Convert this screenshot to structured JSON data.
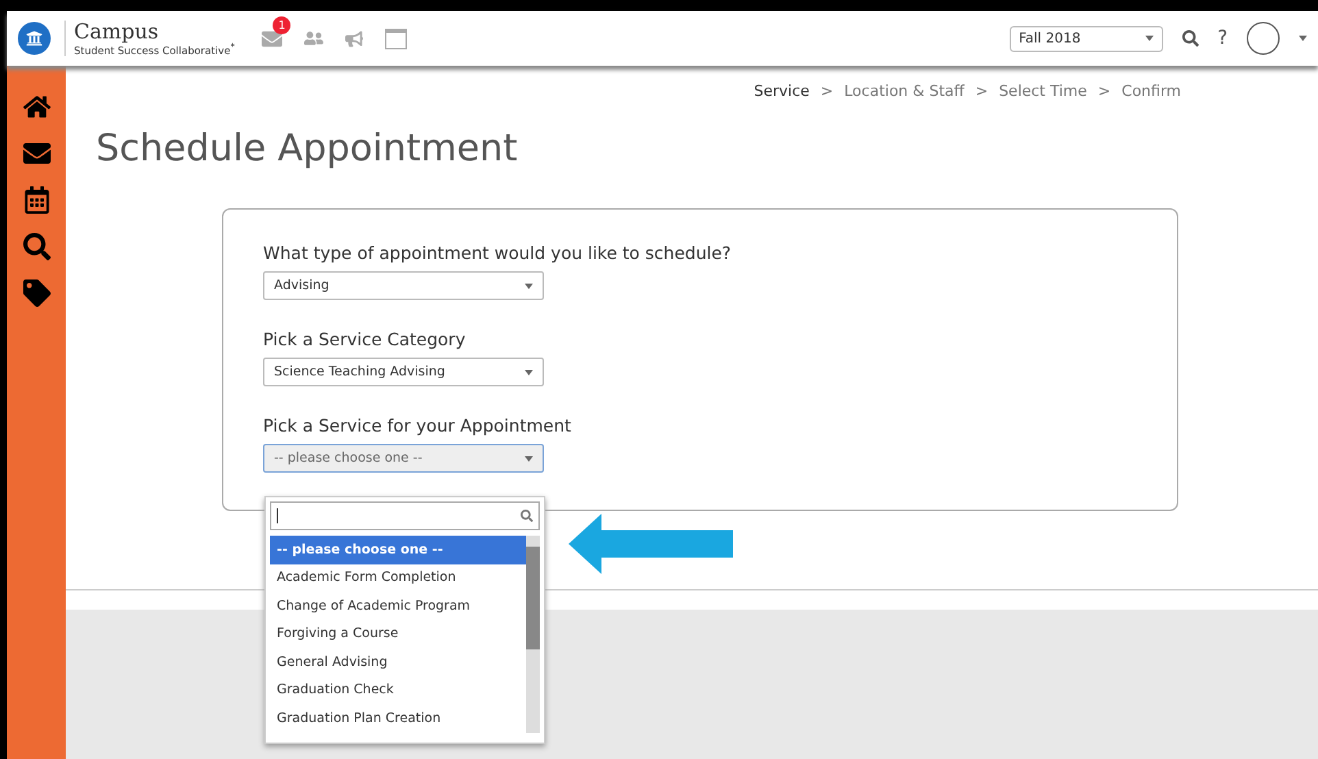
{
  "header": {
    "brand": "Campus",
    "subtitle": "Student Success Collaborative",
    "trademark": "*",
    "notification_count": "1",
    "term": "Fall 2018",
    "help": "?"
  },
  "sidebar": {
    "items": [
      {
        "kind": "home"
      },
      {
        "kind": "mail"
      },
      {
        "kind": "calendar"
      },
      {
        "kind": "search"
      },
      {
        "kind": "tag"
      }
    ]
  },
  "breadcrumb": [
    {
      "label": "Service",
      "selected": true
    },
    {
      "label": "Location & Staff",
      "selected": false
    },
    {
      "label": "Select Time",
      "selected": false
    },
    {
      "label": "Confirm",
      "selected": false
    }
  ],
  "breadcrumb_separator": ">",
  "page_title": "Schedule Appointment",
  "form": {
    "fields": [
      {
        "label": "What type of appointment would you like to schedule?",
        "value": "Advising",
        "expanded": false
      },
      {
        "label": "Pick a Service Category",
        "value": "Science Teaching Advising",
        "expanded": false
      },
      {
        "label": "Pick a Service for your Appointment",
        "value": "-- please choose one --",
        "expanded": true
      }
    ]
  },
  "dropdown": {
    "options": [
      {
        "label": "-- please choose one --",
        "selected": true
      },
      {
        "label": "Academic Form Completion",
        "selected": false
      },
      {
        "label": "Change of Academic Program",
        "selected": false
      },
      {
        "label": "Forgiving a Course",
        "selected": false
      },
      {
        "label": "General Advising",
        "selected": false
      },
      {
        "label": "Graduation Check",
        "selected": false
      },
      {
        "label": "Graduation Plan Creation",
        "selected": false
      }
    ]
  }
}
